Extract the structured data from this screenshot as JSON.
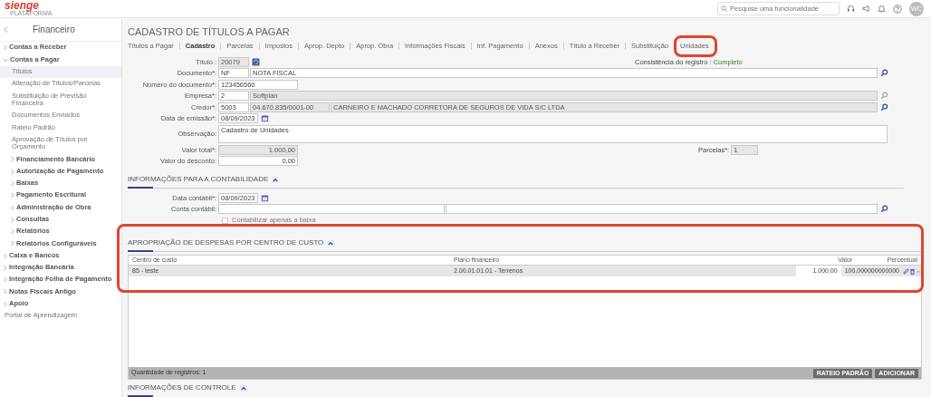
{
  "app": {
    "logo": "sienge",
    "logo_sub": "PLATAFORMA",
    "search_placeholder": "Pesquise uma funcionalidade",
    "avatar": "WC"
  },
  "sidebar": {
    "title": "Financeiro",
    "items": [
      {
        "kind": "group",
        "label": "Contas a Receber",
        "expanded": false
      },
      {
        "kind": "group",
        "label": "Contas a Pagar",
        "expanded": true,
        "children": [
          {
            "kind": "link",
            "label": "Títulos",
            "selected": true
          },
          {
            "kind": "link",
            "label": "Alteração de Títulos/Parcelas",
            "selected": false
          },
          {
            "kind": "link",
            "label": "Substituição de Previsão Financeira",
            "selected": false
          },
          {
            "kind": "link",
            "label": "Documentos Enviados",
            "selected": false
          },
          {
            "kind": "link",
            "label": "Rateio Padrão",
            "selected": false
          },
          {
            "kind": "link",
            "label": "Aprovação de Títulos por Orçamento",
            "selected": false
          },
          {
            "kind": "group",
            "label": "Financiamento Bancário",
            "expanded": false
          },
          {
            "kind": "group",
            "label": "Autorização de Pagamento",
            "expanded": false
          },
          {
            "kind": "group",
            "label": "Baixas",
            "expanded": false
          },
          {
            "kind": "group",
            "label": "Pagamento Escritural",
            "expanded": false
          },
          {
            "kind": "group",
            "label": "Administração de Obra",
            "expanded": false
          },
          {
            "kind": "group",
            "label": "Consultas",
            "expanded": false
          },
          {
            "kind": "group",
            "label": "Relatórios",
            "expanded": false
          },
          {
            "kind": "group",
            "label": "Relatórios Configuráveis",
            "expanded": false
          }
        ]
      },
      {
        "kind": "group",
        "label": "Caixa e Bancos",
        "expanded": false
      },
      {
        "kind": "group",
        "label": "Integração Bancária",
        "expanded": false
      },
      {
        "kind": "group",
        "label": "Integração Folha de Pagamento",
        "expanded": false
      },
      {
        "kind": "group",
        "label": "Notas Fiscais Antigo",
        "expanded": false
      },
      {
        "kind": "group",
        "label": "Apoio",
        "expanded": false
      },
      {
        "kind": "link",
        "label": "Portal de Aprendizagem",
        "selected": false
      }
    ]
  },
  "main": {
    "title": "CADASTRO DE TÍTULOS A PAGAR",
    "tabs": [
      {
        "label": "Títulos a Pagar",
        "selected": false,
        "highlighted": false
      },
      {
        "label": "Cadastro",
        "selected": true,
        "highlighted": false
      },
      {
        "label": "Parcelas",
        "selected": false,
        "highlighted": false
      },
      {
        "label": "Impostos",
        "selected": false,
        "highlighted": false
      },
      {
        "label": "Aprop. Depto",
        "selected": false,
        "highlighted": false
      },
      {
        "label": "Aprop. Obra",
        "selected": false,
        "highlighted": false
      },
      {
        "label": "Informações Fiscais",
        "selected": false,
        "highlighted": false
      },
      {
        "label": "Inf. Pagamento",
        "selected": false,
        "highlighted": false
      },
      {
        "label": "Anexos",
        "selected": false,
        "highlighted": false
      },
      {
        "label": "Título a Receber",
        "selected": false,
        "highlighted": false
      },
      {
        "label": "Substituição",
        "selected": false,
        "highlighted": false
      },
      {
        "label": "Unidades",
        "selected": false,
        "highlighted": true
      }
    ],
    "form": [
      {
        "label": "Título :",
        "fields": [
          {
            "kind": "code",
            "value": "20079",
            "disabled": true
          }
        ],
        "action": {
          "kind": "refresh",
          "disabled": false
        },
        "aside": {
          "kind": "status",
          "label": "Consistência do registro :",
          "value": "Completo"
        }
      },
      {
        "label": "Documento*:",
        "fields": [
          {
            "kind": "code",
            "value": "NF",
            "disabled": false
          },
          {
            "kind": "text",
            "value": "NOTA FISCAL",
            "disabled": false
          }
        ],
        "action": {
          "kind": "search",
          "disabled": false
        }
      },
      {
        "label": "Número do documento*:",
        "fields": [
          {
            "kind": "number",
            "value": "123456560",
            "disabled": false
          }
        ]
      },
      {
        "label": "Empresa*:",
        "fields": [
          {
            "kind": "code",
            "value": "2",
            "disabled": false
          },
          {
            "kind": "text",
            "value": "Softplan",
            "disabled": true
          }
        ],
        "action": {
          "kind": "search",
          "disabled": true
        }
      },
      {
        "label": "Credor*:",
        "fields": [
          {
            "kind": "code",
            "value": "5003",
            "disabled": false
          },
          {
            "kind": "number",
            "value": "04.670.835/0001-00",
            "disabled": true
          },
          {
            "kind": "text",
            "value": "CARNEIRO E MACHADO CORRETORA DE SEGUROS DE VIDA S/C LTDA",
            "disabled": true
          }
        ],
        "action": {
          "kind": "search",
          "disabled": false
        }
      },
      {
        "label": "Data de emissão*:",
        "fields": [
          {
            "kind": "date",
            "value": "08/09/2023",
            "disabled": false
          }
        ],
        "action": {
          "kind": "calendar",
          "disabled": false
        }
      },
      {
        "label": "Observação:",
        "fields": [
          {
            "kind": "multiline",
            "value": "Cadastro de Unidades",
            "disabled": false
          }
        ]
      },
      {
        "label": "Valor total*:",
        "fields": [
          {
            "kind": "amount",
            "value": "1.000,00",
            "disabled": true
          }
        ],
        "aside": {
          "kind": "field",
          "label": "Parcelas*:",
          "value": "1",
          "disabled": true
        }
      },
      {
        "label": "Valor do desconto:",
        "fields": [
          {
            "kind": "amount",
            "value": "0,00",
            "disabled": false
          }
        ]
      }
    ],
    "accounting": {
      "heading": "INFORMAÇÕES PARA A CONTABILIDADE",
      "form": [
        {
          "label": "Data contábil*:",
          "fields": [
            {
              "kind": "date",
              "value": "08/09/2023",
              "disabled": false
            }
          ],
          "action": {
            "kind": "calendar",
            "disabled": false
          }
        },
        {
          "label": "Conta contábil:",
          "fields": [
            {
              "kind": "half",
              "disabled": false
            },
            {
              "kind": "text",
              "disabled": false
            }
          ],
          "action": {
            "kind": "search",
            "disabled": false
          }
        }
      ],
      "checkbox": {
        "label": "Contabilizar apenas a baixa",
        "checked": false,
        "disabled": true
      }
    },
    "costs": {
      "heading": "APROPRIAÇÃO DE DESPESAS POR CENTRO DE CUSTO",
      "highlighted": true,
      "columns": [
        "Centro de custo",
        "Plano financeiro",
        "Valor",
        "Percentual"
      ],
      "rows": [
        {
          "cells": [
            "85 - teste",
            "2.00.01.01.01 - Terrenos",
            "1.000,00",
            "100,000000000000"
          ],
          "selected": true
        }
      ],
      "footer": "Quantidade de registros: 1",
      "buttons": [
        "RATEIO PADRÃO",
        "ADICIONAR"
      ]
    },
    "next_heading": "INFORMAÇÕES DE CONTROLE"
  }
}
